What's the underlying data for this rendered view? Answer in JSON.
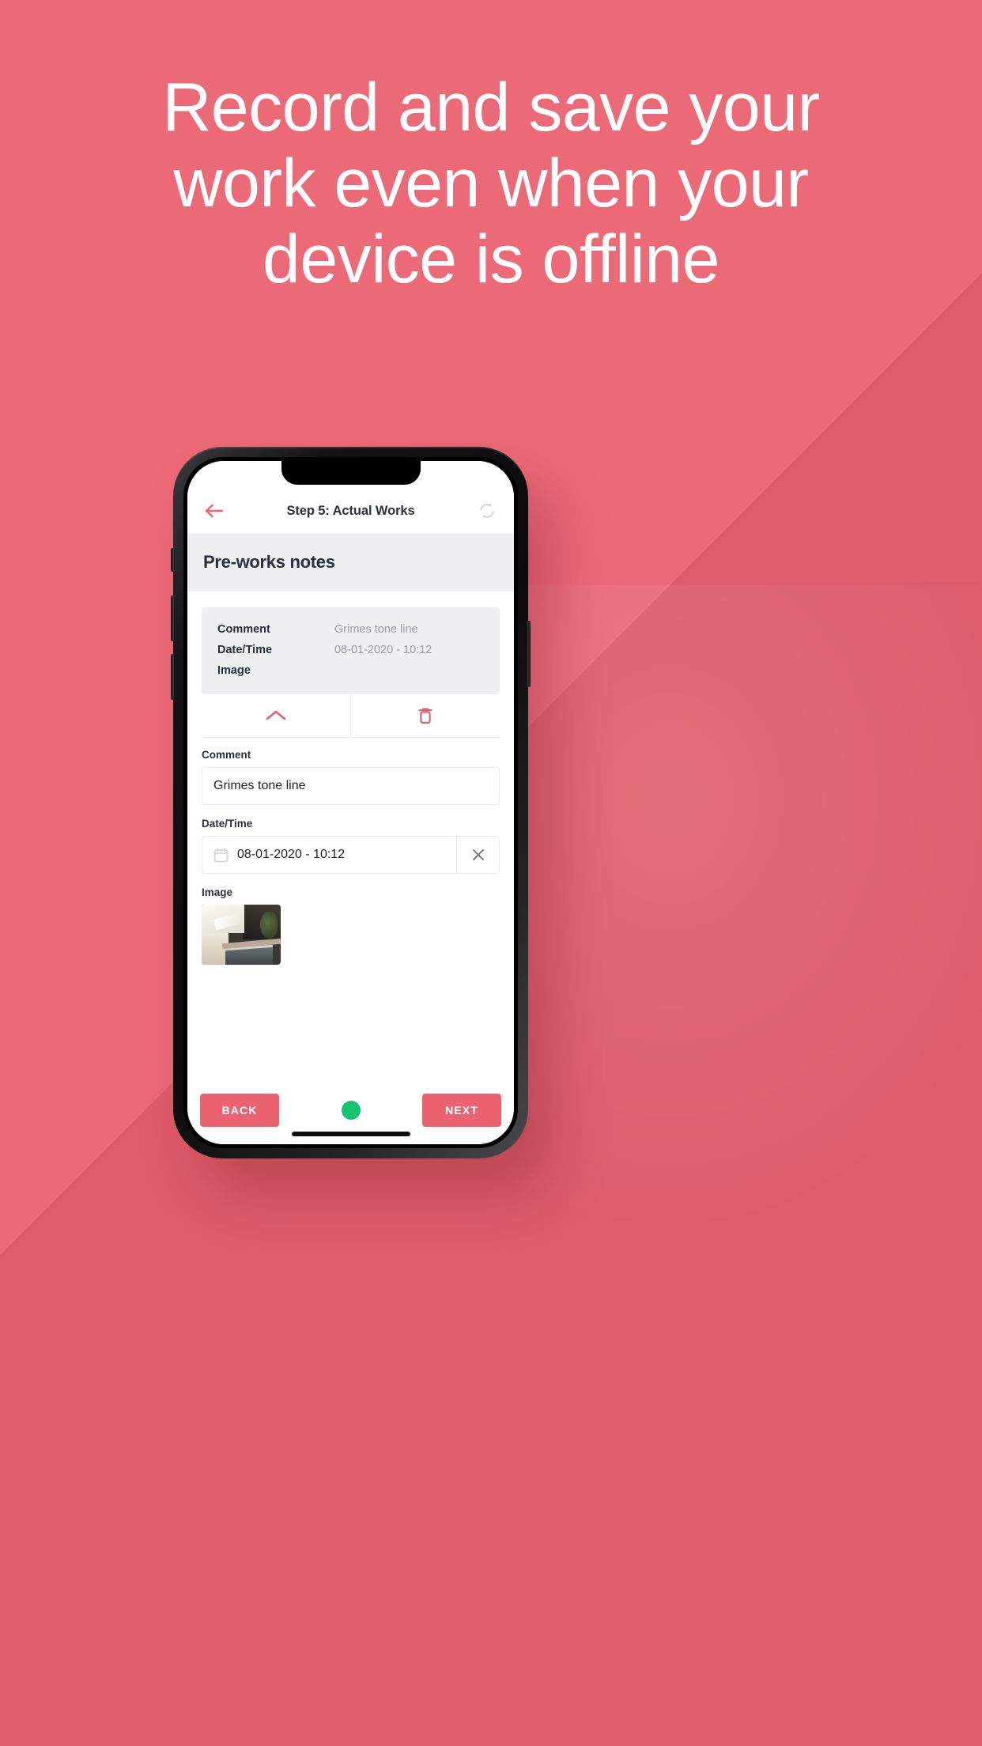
{
  "theme": {
    "brand": "#eb6271",
    "navy": "#28303f",
    "muted": "#9a9da4",
    "panel": "#eff0f2",
    "online": "#14c471"
  },
  "promo": {
    "headline_lines": [
      "Record and save your",
      "work even when your",
      "device is offline"
    ]
  },
  "app": {
    "appbar": {
      "back_icon": "arrow-left-icon",
      "title": "Step 5: Actual Works",
      "sync_icon": "sync-icon"
    },
    "section": {
      "title": "Pre-works notes"
    },
    "summary": {
      "rows": [
        {
          "key": "Comment",
          "value": "Grimes tone line"
        },
        {
          "key": "Date/Time",
          "value": "08-01-2020 - 10:12"
        },
        {
          "key": "Image",
          "value": ""
        }
      ]
    },
    "actions": [
      {
        "name": "collapse-button",
        "icon": "chevron-up-icon"
      },
      {
        "name": "delete-button",
        "icon": "trash-icon"
      }
    ],
    "form": {
      "comment": {
        "label": "Comment",
        "value": "Grimes tone line",
        "placeholder": "Comment"
      },
      "datetime": {
        "label": "Date/Time",
        "value": "08-01-2020 - 10:12",
        "placeholder": "Select date and time",
        "calendar_icon": "calendar-icon",
        "clear_icon": "close-icon"
      },
      "image": {
        "label": "Image"
      }
    },
    "bottombar": {
      "back_label": "BACK",
      "next_label": "NEXT",
      "status": "online"
    }
  }
}
